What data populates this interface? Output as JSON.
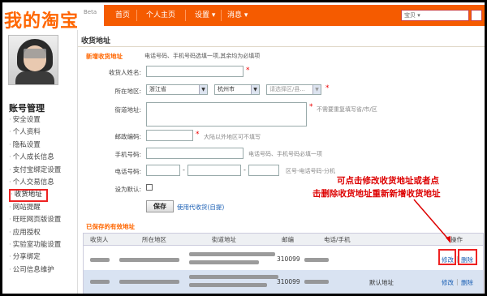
{
  "header": {
    "logo": "我的淘宝",
    "beta": "Beta",
    "nav": [
      "首页",
      "个人主页",
      "设置 ▾",
      "消息 ▾"
    ],
    "search_value": "宝贝 ▾"
  },
  "sidebar": {
    "title": "账号管理",
    "items": [
      {
        "label": "安全设置",
        "active": false
      },
      {
        "label": "个人资料",
        "active": false
      },
      {
        "label": "隐私设置",
        "active": false
      },
      {
        "label": "个人成长信息",
        "active": false
      },
      {
        "label": "支付宝绑定设置",
        "active": false
      },
      {
        "label": "个人交易信息",
        "active": false
      },
      {
        "label": "收货地址",
        "active": true
      },
      {
        "label": "网站提醒",
        "active": false
      },
      {
        "label": "旺旺网页版设置",
        "active": false
      },
      {
        "label": "应用授权",
        "active": false
      },
      {
        "label": "实验室功能设置",
        "active": false
      },
      {
        "label": "分享绑定",
        "active": false
      },
      {
        "label": "公司信息维护",
        "active": false
      }
    ]
  },
  "main": {
    "title": "收货地址",
    "new_section_title": "新增收货地址",
    "new_section_note": "电话号码、手机号码选填一项,其余均为必填项",
    "form": {
      "name_label": "收货人姓名:",
      "region_label": "所在地区:",
      "province": "浙江省",
      "city": "杭州市",
      "district": "请选择区/县...",
      "street_label": "街道地址:",
      "street_hint": "不需要重复填写省/市/区",
      "zip_label": "邮政编码:",
      "zip_hint": "大陆以外地区可不填写",
      "mobile_label": "手机号码:",
      "mobile_hint": "电话号码、手机号码必填一项",
      "phone_label": "电话号码:",
      "phone_hint": "区号-电话号码-分机",
      "default_label": "设为默认:",
      "save_button": "保存",
      "use_link": "使用代收货(自提)",
      "required_mark": "*",
      "dash": "-"
    },
    "saved_title": "已保存的有效地址",
    "table": {
      "headers": [
        "收货人",
        "所在地区",
        "街道地址",
        "邮编",
        "电话/手机",
        "操作"
      ],
      "rows": [
        {
          "zip": "310099",
          "default": "",
          "edit": "修改",
          "sep": "|",
          "delete": "删除"
        },
        {
          "zip": "310099",
          "default": "默认地址",
          "edit": "修改",
          "sep": "|",
          "delete": "删除"
        }
      ]
    }
  },
  "annotation": {
    "line1": "可点击修改收货地址或者点",
    "line2": "击删除收货地址重新新增收货地址"
  },
  "colors": {
    "brand": "#f55b00",
    "annotation": "#dd0000",
    "link": "#1a5fb4"
  }
}
